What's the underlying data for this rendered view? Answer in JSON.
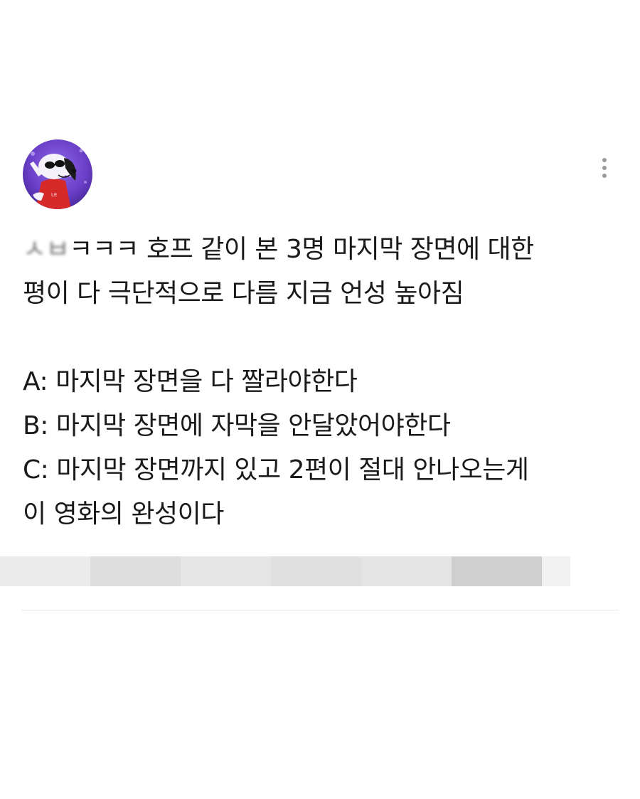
{
  "post": {
    "author_prefix_blurred": "ㅅㅂ",
    "lines": [
      "ㅋㅋㅋ 호프 같이 본 3명 마지막 장면에 대한",
      "평이 다 극단적으로 다름 지금 언성 높아짐",
      "A: 마지막 장면을 다 짤라야한다",
      "B: 마지막 장면에 자막을 안달았어야한다",
      "C: 마지막 장면까지 있고 2편이 절대 안나오는게",
      "이 영화의 완성이다"
    ]
  },
  "icons": {
    "avatar": "snoopy-avatar",
    "more": "vertical-ellipsis-icon"
  },
  "colors": {
    "background": "#ffffff",
    "text": "#1a1a1a",
    "avatar_bg": "#6a3fc8",
    "divider": "#e4e4e4",
    "more_dots": "#9a9a9a"
  }
}
